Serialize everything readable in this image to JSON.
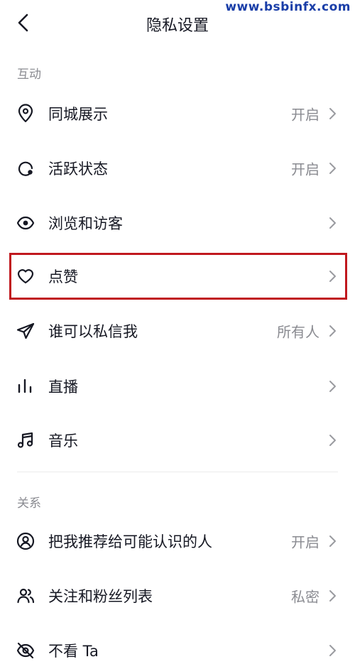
{
  "watermark": "www.bsbinfx.com",
  "header": {
    "title": "隐私设置"
  },
  "sections": [
    {
      "title": "互动",
      "items": [
        {
          "label": "同城展示",
          "value": "开启"
        },
        {
          "label": "活跃状态",
          "value": "开启"
        },
        {
          "label": "浏览和访客",
          "value": ""
        },
        {
          "label": "点赞",
          "value": ""
        },
        {
          "label": "谁可以私信我",
          "value": "所有人"
        },
        {
          "label": "直播",
          "value": ""
        },
        {
          "label": "音乐",
          "value": ""
        }
      ]
    },
    {
      "title": "关系",
      "items": [
        {
          "label": "把我推荐给可能认识的人",
          "value": "开启"
        },
        {
          "label": "关注和粉丝列表",
          "value": "私密"
        },
        {
          "label": "不看 Ta",
          "value": ""
        }
      ]
    }
  ],
  "colors": {
    "highlight": "#c0181e",
    "text": "#161823",
    "secondary": "#8a8b91"
  }
}
